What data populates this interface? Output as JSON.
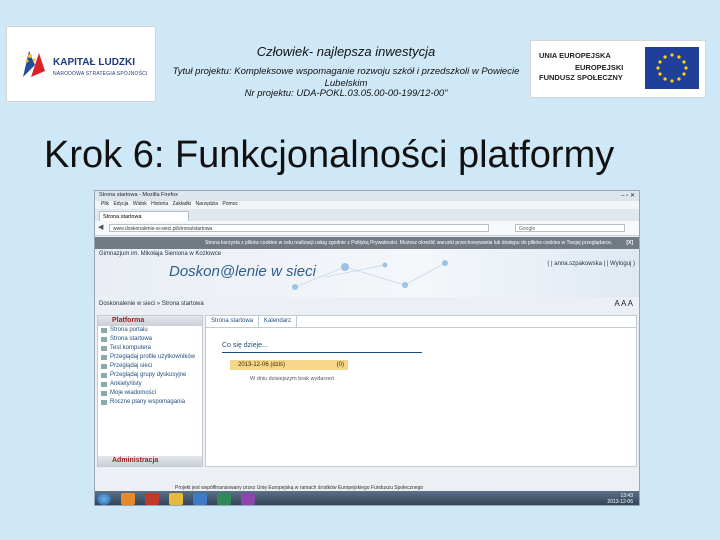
{
  "header": {
    "left_logo": {
      "name": "KAPITAŁ LUDZKI",
      "sub": "NARODOWA STRATEGIA SPÓJNOŚCI"
    },
    "slogan": "Człowiek- najlepsza inwestycja",
    "project_title": "Tytuł projektu: Kompleksowe wspomaganie rozwoju szkół i przedszkoli w Powiecie Lubelskim",
    "project_number": "Nr projektu: UDA-POKL.03.05.00-00-199/12-00”",
    "right_logo": {
      "line1": "UNIA EUROPEJSKA",
      "line2": "EUROPEJSKI",
      "line3": "FUNDUSZ SPOŁECZNY"
    }
  },
  "title": "Krok 6: Funkcjonalności platformy",
  "screenshot": {
    "browser_title": "Strona startowa - Mozilla Firefox",
    "menu": [
      "Plik",
      "Edycja",
      "Widok",
      "Historia",
      "Zakładki",
      "Narzędzia",
      "Pomoc"
    ],
    "tab_label": "Strona startowa",
    "url": "www.doskonalenie-w-sieci.pl/strona/startowa",
    "search_placeholder": "Google",
    "cookie_text": "Strona korzysta z plików cookies w celu realizacji usług zgodnie z Polityką Prywatności. Możesz określić warunki przechowywania lub dostępu do plików cookies w Twojej przeglądarce.",
    "cookie_close": "[X]",
    "school_name": "Gimnazjum im. Mikołaja Sieniona w Kozłowce",
    "portal_name": "Doskon@lenie w sieci",
    "user_bar": "( | anna.szpakowska | | Wyloguj )",
    "breadcrumb": "Doskonalenie w sieci » Strona startowa",
    "zoom_label": "A A A",
    "sidebar": {
      "header": "Platforma",
      "items": [
        "Strona portalu",
        "Strona startowa",
        "Test komputera",
        "Przeglądaj profile użytkowników",
        "Przeglądaj sieci",
        "Przeglądaj grupy dyskusyjne",
        "Ankiety/listy",
        "Moje wiadomości",
        "Roczne plany wspomagania"
      ],
      "admin_header": "Administracja"
    },
    "main_tabs": [
      "Strona startowa",
      "Kalendarz"
    ],
    "whats_new": "Co się dzieje...",
    "date_label": "2013-12-06 (dziś)",
    "date_count": "(0)",
    "no_events": "W dniu dzisiejszym brak wydarzeń",
    "footer": "Projekt jest współfinansowany przez Unię Europejską w ramach środków Europejskiego Funduszu Społecznego",
    "clock": {
      "time": "13:43",
      "date": "2013-12-06"
    }
  }
}
